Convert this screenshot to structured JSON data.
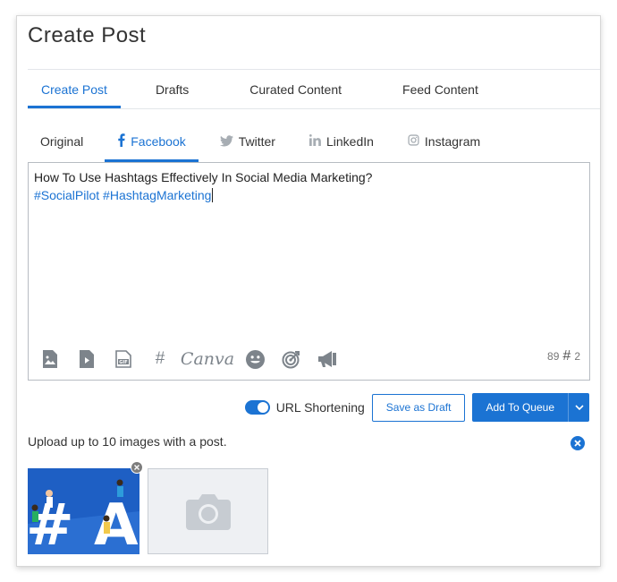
{
  "page": {
    "title": "Create Post"
  },
  "main_tabs": [
    {
      "label": "Create Post",
      "active": true
    },
    {
      "label": "Drafts",
      "active": false
    },
    {
      "label": "Curated Content",
      "active": false
    },
    {
      "label": "Feed Content",
      "active": false
    }
  ],
  "network_tabs": [
    {
      "label": "Original",
      "icon": "",
      "active": false
    },
    {
      "label": "Facebook",
      "icon": "facebook-icon",
      "active": true
    },
    {
      "label": "Twitter",
      "icon": "twitter-icon",
      "active": false
    },
    {
      "label": "LinkedIn",
      "icon": "linkedin-icon",
      "active": false
    },
    {
      "label": "Instagram",
      "icon": "instagram-icon",
      "active": false
    }
  ],
  "editor": {
    "line1": "How To Use Hashtags Effectively In Social Media Marketing?",
    "hashtags": "#SocialPilot #HashtagMarketing",
    "toolbar": [
      "image-icon",
      "video-icon",
      "gif-icon",
      "hashtag-icon",
      "canva-logo",
      "emoji-icon",
      "target-icon",
      "megaphone-icon"
    ],
    "canva_label": "Canva",
    "hashtag_symbol": "#",
    "char_count": "89",
    "hashtag_count": "2"
  },
  "actions": {
    "url_shortening_label": "URL Shortening",
    "url_shortening_on": true,
    "save_draft_label": "Save as Draft",
    "add_queue_label": "Add To Queue"
  },
  "upload": {
    "text": "Upload up to 10 images with a post."
  },
  "colors": {
    "accent": "#1b73d3",
    "icon_gray": "#7d848b",
    "border": "#b7bcc2"
  }
}
